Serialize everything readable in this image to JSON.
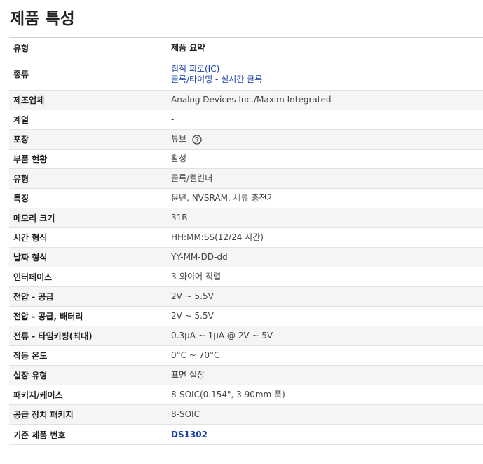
{
  "page_title": "제품 특성",
  "header": {
    "label": "유형",
    "value": "제품 요약"
  },
  "rows": [
    {
      "label": "종류",
      "links": [
        "집적 회로(IC)",
        "클록/타이밍 - 실시간 클록"
      ]
    },
    {
      "label": "제조업체",
      "value": "Analog Devices Inc./Maxim Integrated"
    },
    {
      "label": "계열",
      "value": "-"
    },
    {
      "label": "포장",
      "value": "튜브",
      "icon": "help-circle-icon"
    },
    {
      "label": "부품 현황",
      "value": "활성"
    },
    {
      "label": "유형",
      "value": "클록/캘린더"
    },
    {
      "label": "특징",
      "value": "윤년, NVSRAM, 세류 충전기"
    },
    {
      "label": "메모리 크기",
      "value": "31B"
    },
    {
      "label": "시간 형식",
      "value": "HH:MM:SS(12/24 시간)"
    },
    {
      "label": "날짜 형식",
      "value": "YY-MM-DD-dd"
    },
    {
      "label": "인터페이스",
      "value": "3-와이어 직렬"
    },
    {
      "label": "전압 - 공급",
      "value": "2V ~ 5.5V"
    },
    {
      "label": "전압 - 공급, 배터리",
      "value": "2V ~ 5.5V"
    },
    {
      "label": "전류 - 타임키핑(최대)",
      "value": "0.3µA ~ 1µA @ 2V ~ 5V"
    },
    {
      "label": "작동 온도",
      "value": "0°C ~ 70°C"
    },
    {
      "label": "실장 유형",
      "value": "표면 실장"
    },
    {
      "label": "패키지/케이스",
      "value": "8-SOIC(0.154\", 3.90mm 폭)"
    },
    {
      "label": "공급 장치 패키지",
      "value": "8-SOIC"
    },
    {
      "label": "기준 제품 번호",
      "link": "DS1302"
    }
  ],
  "colors": {
    "link": "#1a3fa8",
    "alt_row": "#f5f5f5"
  }
}
